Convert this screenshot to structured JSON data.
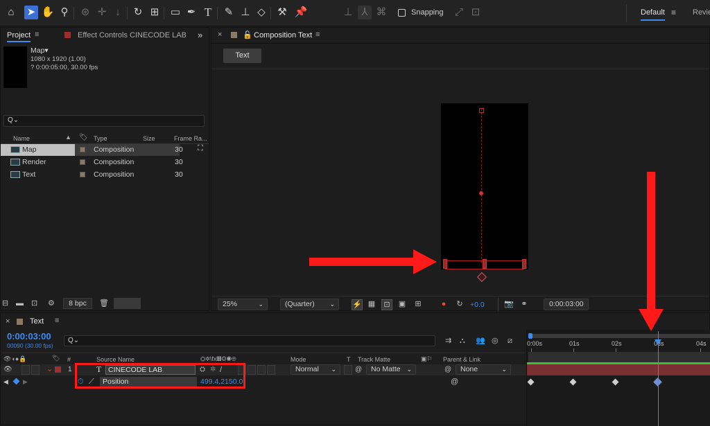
{
  "toolbar": {
    "snapping_label": "Snapping",
    "workspace_active": "Default",
    "workspace_next": "Revie",
    "menu_icon": "≡"
  },
  "project_panel": {
    "tab_label": "Project",
    "effect_controls_label": "Effect Controls CINECODE LAB",
    "comp_name": "Map▾",
    "comp_resolution": "1080 x 1920 (1.00)",
    "comp_duration": "? 0:00:05:00, 30.00 fps",
    "search_glyph": "Q⌄",
    "columns": {
      "name": "Name",
      "type": "Type",
      "size": "Size",
      "frame_rate": "Frame Ra..."
    },
    "items": [
      {
        "name": "Map",
        "type": "Composition",
        "fps": "30"
      },
      {
        "name": "Render",
        "type": "Composition",
        "fps": "30"
      },
      {
        "name": "Text",
        "type": "Composition",
        "fps": "30"
      }
    ],
    "bpc": "8 bpc"
  },
  "composition_panel": {
    "tab_label": "Composition Text",
    "flow_button": "Text",
    "zoom": "25%",
    "resolution": "(Quarter)",
    "exposure": "+0.0",
    "timecode": "0:00:03:00"
  },
  "timeline": {
    "tab_label": "Text",
    "current_time": "0:00:03:00",
    "frame_info": "00090 (30.00 fps)",
    "search_glyph": "Q⌄",
    "columns": {
      "hash": "#",
      "source_name": "Source Name",
      "mode": "Mode",
      "t": "T",
      "track_matte": "Track Matte",
      "parent": "Parent & Link"
    },
    "ruler": [
      "0:00s",
      "01s",
      "02s",
      "03s",
      "04s"
    ],
    "layer": {
      "number": "1",
      "type_glyph": "T",
      "name": "CINECODE LAB",
      "mode": "Normal",
      "matte": "No Matte",
      "parent": "None"
    },
    "property": {
      "name": "Position",
      "value": "499.4,2150.0"
    },
    "keyframes_seconds": [
      0,
      1,
      2,
      3
    ],
    "playhead_seconds": 3
  },
  "colors": {
    "accent_blue": "#3b8bf0",
    "annotation_red": "#ff1a1a",
    "layer_bar": "#7a3030"
  }
}
